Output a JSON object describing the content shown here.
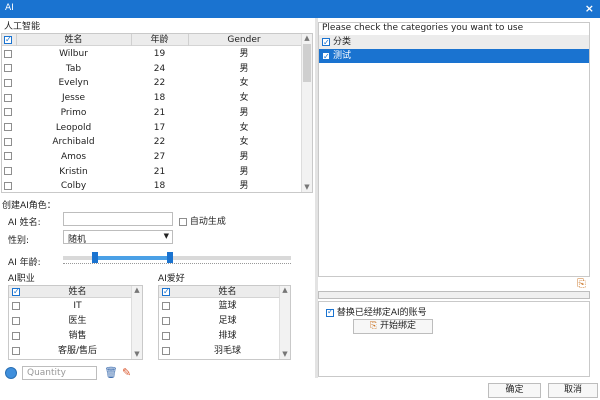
{
  "window": {
    "title": "AI",
    "close": "×"
  },
  "grid": {
    "title": "人工智能",
    "columns": [
      "姓名",
      "年龄",
      "Gender"
    ],
    "rows": [
      [
        "Wilbur",
        "19",
        "男"
      ],
      [
        "Tab",
        "24",
        "男"
      ],
      [
        "Evelyn",
        "22",
        "女"
      ],
      [
        "Jesse",
        "18",
        "女"
      ],
      [
        "Primo",
        "21",
        "男"
      ],
      [
        "Leopold",
        "17",
        "女"
      ],
      [
        "Archibald",
        "22",
        "女"
      ],
      [
        "Amos",
        "27",
        "男"
      ],
      [
        "Kristin",
        "21",
        "男"
      ],
      [
        "Colby",
        "18",
        "男"
      ]
    ]
  },
  "form": {
    "create_title": "创建AI角色：",
    "name_label": "AI 姓名:",
    "name_value": "",
    "auto_label": "自动生成",
    "gender_label": "性别:",
    "gender_value": "随机",
    "age_label": "AI 年龄:",
    "age_range_min": 0.14,
    "age_range_max": 0.47
  },
  "occupation": {
    "title": "AI职业",
    "column": "姓名",
    "items": [
      "IT",
      "医生",
      "销售",
      "客服/售后"
    ]
  },
  "hobby": {
    "title": "AI爱好",
    "column": "姓名",
    "items": [
      "篮球",
      "足球",
      "排球",
      "羽毛球"
    ]
  },
  "bottom": {
    "quantity_placeholder": "Quantity"
  },
  "categories": {
    "title": "Please check the categories you want to use",
    "items": [
      {
        "label": "分类",
        "checked": true,
        "selected": false
      },
      {
        "label": "测试",
        "checked": true,
        "selected": true
      }
    ]
  },
  "bind": {
    "replace_label": "替换已经绑定AI的账号",
    "replace_checked": true,
    "start_label": "开始绑定"
  },
  "footer": {
    "ok": "确定",
    "cancel": "取消"
  },
  "colors": {
    "accent": "#1a73d0",
    "selection": "#1a73d0"
  }
}
